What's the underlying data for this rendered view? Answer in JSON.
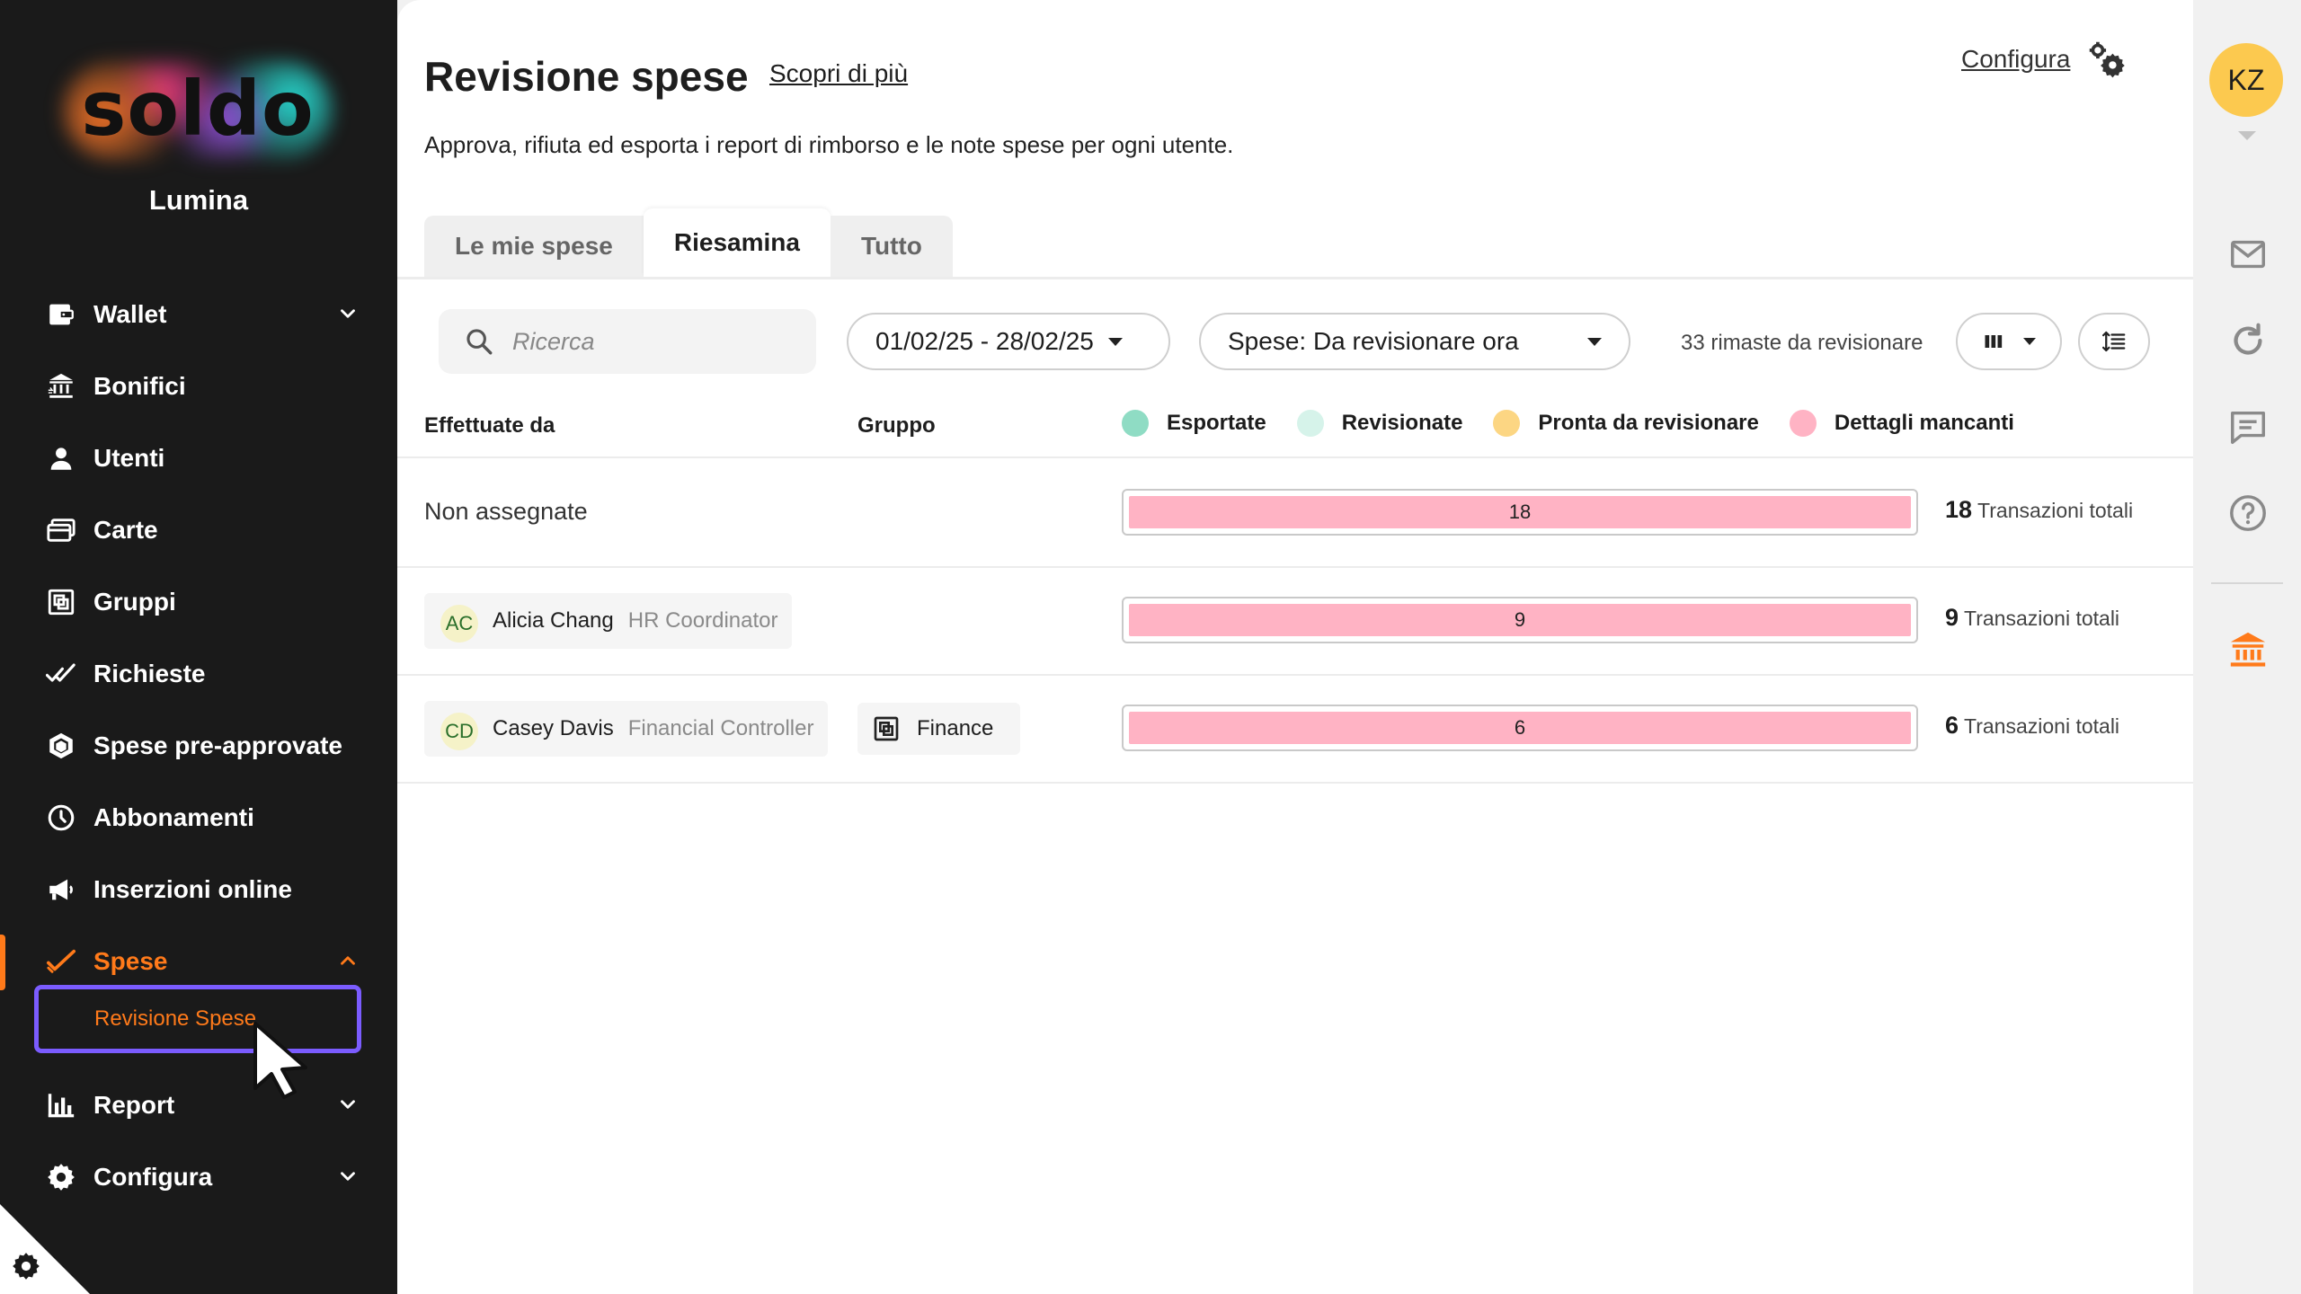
{
  "sidebar": {
    "logo_text": "soldo",
    "org_name": "Lumina",
    "items": [
      {
        "label": "Wallet",
        "icon": "wallet-icon",
        "chevron": "down"
      },
      {
        "label": "Bonifici",
        "icon": "bank-transfer-icon"
      },
      {
        "label": "Utenti",
        "icon": "user-icon"
      },
      {
        "label": "Carte",
        "icon": "cards-icon"
      },
      {
        "label": "Gruppi",
        "icon": "groups-icon"
      },
      {
        "label": "Richieste",
        "icon": "double-check-icon"
      },
      {
        "label": "Spese pre-approvate",
        "icon": "hexagon-icon"
      },
      {
        "label": "Abbonamenti",
        "icon": "clock-icon"
      },
      {
        "label": "Inserzioni online",
        "icon": "megaphone-icon"
      },
      {
        "label": "Spese",
        "icon": "check-icon",
        "chevron": "up",
        "active": true
      },
      {
        "label": "Report",
        "icon": "bar-chart-icon",
        "chevron": "down"
      },
      {
        "label": "Configura",
        "icon": "gear-icon",
        "chevron": "down"
      }
    ],
    "active_subitem": "Revisione Spese",
    "accent_color": "#ff7a1a",
    "highlight_color": "#7b5cff"
  },
  "header": {
    "title": "Revisione spese",
    "learn_more": "Scopri di più",
    "configure_link": "Configura",
    "subtitle": "Approva, rifiuta ed esporta i report di rimborso e le note spese per ogni utente."
  },
  "tabs": [
    {
      "label": "Le mie spese",
      "selected": false
    },
    {
      "label": "Riesamina",
      "selected": true
    },
    {
      "label": "Tutto",
      "selected": false
    }
  ],
  "toolbar": {
    "search_placeholder": "Ricerca",
    "date_range": "01/02/25 - 28/02/25",
    "filter": "Spese: Da revisionare ora",
    "remaining": "33 rimaste da revisionare"
  },
  "table": {
    "columns": {
      "made_by": "Effettuate da",
      "group": "Gruppo"
    },
    "legend": [
      {
        "label": "Esportate",
        "color": "#8fdcc4"
      },
      {
        "label": "Revisionate",
        "color": "#d6f3ea"
      },
      {
        "label": "Pronta da revisionare",
        "color": "#fcd683"
      },
      {
        "label": "Dettagli mancanti",
        "color": "#ffb3c4"
      }
    ],
    "rows": [
      {
        "name": "Non assegnate",
        "initials": "",
        "role": "",
        "group": "",
        "missing_details": 18,
        "total": "18",
        "total_label": "Transazioni totali"
      },
      {
        "name": "Alicia Chang",
        "initials": "AC",
        "role": "HR Coordinator",
        "group": "",
        "missing_details": 9,
        "total": "9",
        "total_label": "Transazioni totali"
      },
      {
        "name": "Casey Davis",
        "initials": "CD",
        "role": "Financial Controller",
        "group": "Finance",
        "missing_details": 6,
        "total": "6",
        "total_label": "Transazioni totali"
      }
    ]
  },
  "rail": {
    "user_initials": "KZ",
    "icons": [
      "mail-icon",
      "refresh-icon",
      "chat-icon",
      "help-icon",
      "bank-icon"
    ]
  }
}
